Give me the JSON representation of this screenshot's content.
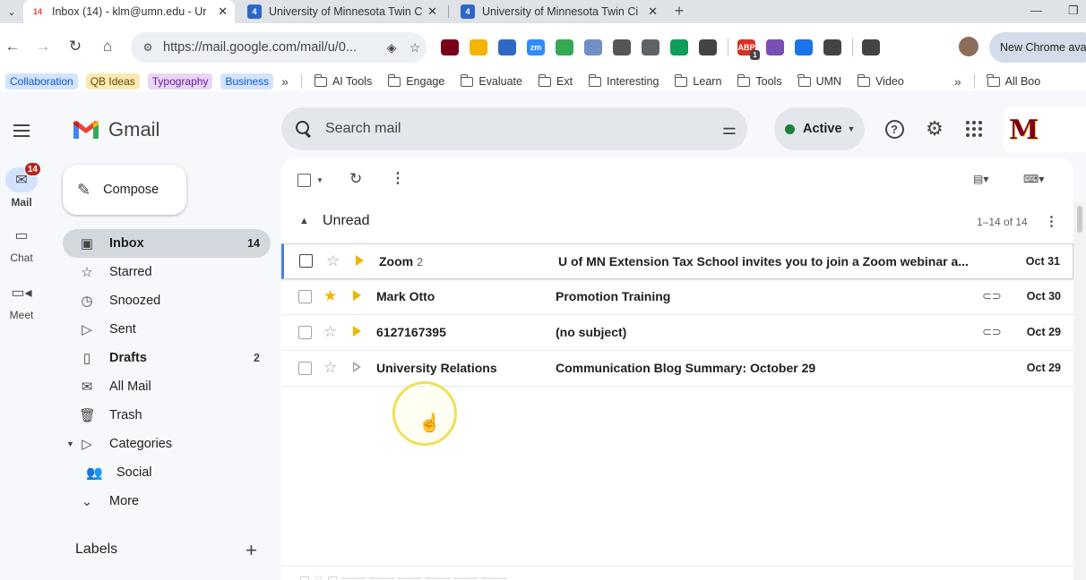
{
  "browser": {
    "tabs": [
      {
        "title": "Inbox (14) - klm@umn.edu - Ur",
        "favicon": "gmail-favicon",
        "favicon_text": "14",
        "active": true
      },
      {
        "title": "University of Minnesota Twin Ci",
        "favicon": "umn-favicon",
        "favicon_text": "4",
        "active": false
      },
      {
        "title": "University of Minnesota Twin Ci",
        "favicon": "umn-favicon",
        "favicon_text": "4",
        "active": false
      }
    ],
    "url": "https://mail.google.com/mail/u/0...",
    "extensions": [
      {
        "icon": "umn-extension-icon",
        "color": "#7a0019"
      },
      {
        "icon": "keep-extension-icon",
        "color": "#f4b400"
      },
      {
        "icon": "wifi-extension-icon",
        "color": "#2f67c7"
      },
      {
        "icon": "zoom-extension-icon",
        "color": "#2d8cff",
        "text": "zm"
      },
      {
        "icon": "drive-extension-icon",
        "color": "#34a853"
      },
      {
        "icon": "signature-extension-icon",
        "color": "#6f8fc7"
      },
      {
        "icon": "gamepad-extension-icon",
        "color": "#555555"
      },
      {
        "icon": "image-extension-icon",
        "color": "#5f6368"
      },
      {
        "icon": "screenshot-extension-icon",
        "color": "#0f9d58"
      },
      {
        "icon": "pip-extension-icon",
        "color": "#444444"
      },
      {
        "icon": "adblock-extension-icon",
        "color": "#d93025",
        "text": "ABP",
        "badge": "1"
      },
      {
        "icon": "brain-extension-icon",
        "color": "#7a4fb5"
      },
      {
        "icon": "layers-extension-icon",
        "color": "#1a73e8"
      },
      {
        "icon": "puzzle-extension-icon",
        "color": "#444444"
      }
    ],
    "update_text": "New Chrome avail",
    "bookmarks_chips": [
      {
        "label": "Collaboration",
        "bg": "#d3e3fd",
        "fg": "#0b57d0"
      },
      {
        "label": "QB Ideas",
        "bg": "#fce8b2",
        "fg": "#5f4b00"
      },
      {
        "label": "Typography",
        "bg": "#e9d5f5",
        "fg": "#6a1b9a"
      },
      {
        "label": "Business",
        "bg": "#d3e3fd",
        "fg": "#0b57d0"
      }
    ],
    "bookmark_folders": [
      "AI Tools",
      "Engage",
      "Evaluate",
      "Ext",
      "Interesting",
      "Learn",
      "Tools",
      "UMN",
      "Video"
    ],
    "all_bookmarks": "All Boo"
  },
  "gmail": {
    "logo_text": "Gmail",
    "search_placeholder": "Search mail",
    "status": "Active",
    "compose": "Compose",
    "rail": [
      {
        "label": "Mail",
        "badge": "14",
        "icon": "mail-icon"
      },
      {
        "label": "Chat",
        "icon": "chat-icon"
      },
      {
        "label": "Meet",
        "icon": "video-icon"
      }
    ],
    "nav": [
      {
        "label": "Inbox",
        "count": "14",
        "icon": "inbox-icon",
        "glyph": "▣",
        "active": true
      },
      {
        "label": "Starred",
        "count": "",
        "icon": "star-icon",
        "glyph": "☆"
      },
      {
        "label": "Snoozed",
        "count": "",
        "icon": "clock-icon",
        "glyph": "◷"
      },
      {
        "label": "Sent",
        "count": "",
        "icon": "send-icon",
        "glyph": "▷"
      },
      {
        "label": "Drafts",
        "count": "2",
        "icon": "draft-icon",
        "glyph": "▯",
        "bold": true
      },
      {
        "label": "All Mail",
        "count": "",
        "icon": "all-mail-icon",
        "glyph": "✉"
      },
      {
        "label": "Trash",
        "count": "",
        "icon": "trash-icon",
        "glyph": "🗑"
      },
      {
        "label": "Categories",
        "count": "",
        "icon": "label-icon",
        "glyph": "▷",
        "caret": true
      },
      {
        "label": "Social",
        "count": "",
        "icon": "social-icon",
        "glyph": "👥",
        "sub": true
      },
      {
        "label": "More",
        "count": "",
        "icon": "chevron-down-icon",
        "glyph": "⌄"
      }
    ],
    "labels_heading": "Labels",
    "section": {
      "title": "Unread",
      "count": "1–14 of 14"
    },
    "emails": [
      {
        "sender": "Zoom",
        "thread_count": "2",
        "subject": "U of MN Extension Tax School invites you to join a Zoom webinar a...",
        "date": "Oct 31",
        "starred": false,
        "important": true,
        "attachment": false,
        "focused": true
      },
      {
        "sender": "Mark Otto",
        "thread_count": "",
        "subject": "Promotion Training",
        "date": "Oct 30",
        "starred": true,
        "important": true,
        "attachment": true,
        "focused": false
      },
      {
        "sender": "6127167395",
        "thread_count": "",
        "subject": "(no subject)",
        "date": "Oct 29",
        "starred": false,
        "important": true,
        "attachment": true,
        "focused": false
      },
      {
        "sender": "University Relations",
        "thread_count": "",
        "subject": "Communication Blog Summary: October 29",
        "date": "Oct 29",
        "starred": false,
        "important": false,
        "attachment": false,
        "focused": false
      }
    ],
    "org_logo_text": "M"
  }
}
